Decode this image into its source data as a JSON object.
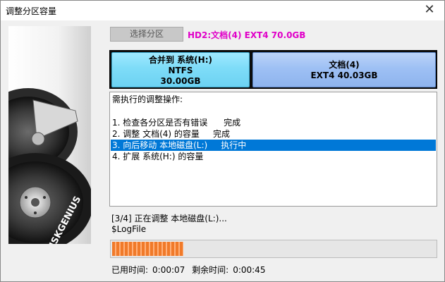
{
  "window": {
    "title": "调整分区容量",
    "close_glyph": "✕"
  },
  "banner": {
    "brand": "DISKGENIUS"
  },
  "target": {
    "select_button_label": "选择分区",
    "label": "HD2:文档(4)  EXT4 70.0GB"
  },
  "partitions": [
    {
      "line1": "合并到 系统(H:)",
      "line2": "NTFS",
      "line3": "30.00GB"
    },
    {
      "line1": "文档(4)",
      "line2": "EXT4 40.03GB",
      "line3": ""
    }
  ],
  "operations": {
    "header": "需执行的调整操作:",
    "items": [
      {
        "text": "1. 检查各分区是否有错误      完成",
        "selected": false
      },
      {
        "text": "2. 调整 文档(4) 的容量     完成",
        "selected": false
      },
      {
        "text": "3. 向后移动 本地磁盘(L:)     执行中",
        "selected": true
      },
      {
        "text": "4. 扩展 系统(H:) 的容量",
        "selected": false
      }
    ]
  },
  "status": {
    "line1": "[3/4] 正在调整 本地磁盘(L:)...",
    "line2": "$LogFile"
  },
  "progress": {
    "fraction": 0.22
  },
  "times": {
    "elapsed_label": "已用时间:",
    "elapsed_value": "0:00:07",
    "remaining_label": "剩余时间:",
    "remaining_value": "0:00:45"
  },
  "colors": {
    "accent_selection": "#0078d7",
    "target_label": "#e000c8",
    "progress_fill": "#f07a2a"
  }
}
